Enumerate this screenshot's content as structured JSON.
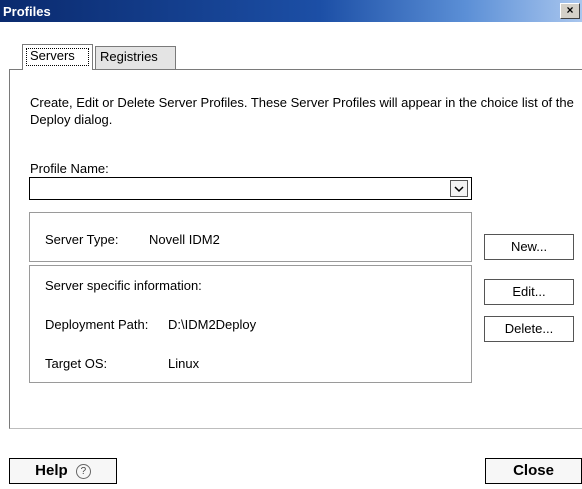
{
  "window": {
    "title": "Profiles",
    "close_glyph": "×"
  },
  "tabs": [
    {
      "label": "Servers",
      "selected": true
    },
    {
      "label": "Registries",
      "selected": false
    }
  ],
  "description": "Create, Edit or Delete Server Profiles.  These Server Profiles will appear in the choice list of the Deploy dialog.",
  "profile_name": {
    "label": "Profile Name:",
    "value": "",
    "dropdown_icon": "chevron-down-icon"
  },
  "server_type": {
    "label": "Server Type:",
    "value": "Novell IDM2"
  },
  "server_info": {
    "heading": "Server specific information:",
    "deployment_path_label": "Deployment Path:",
    "deployment_path_value": "D:\\IDM2Deploy",
    "target_os_label": "Target OS:",
    "target_os_value": "Linux"
  },
  "side_buttons": {
    "new": "New...",
    "edit": "Edit...",
    "delete": "Delete..."
  },
  "bottom": {
    "help": "Help",
    "help_icon": "?",
    "close": "Close"
  },
  "colors": {
    "titlebar_start": "#0a2a6e",
    "titlebar_end": "#a9c6ee"
  }
}
